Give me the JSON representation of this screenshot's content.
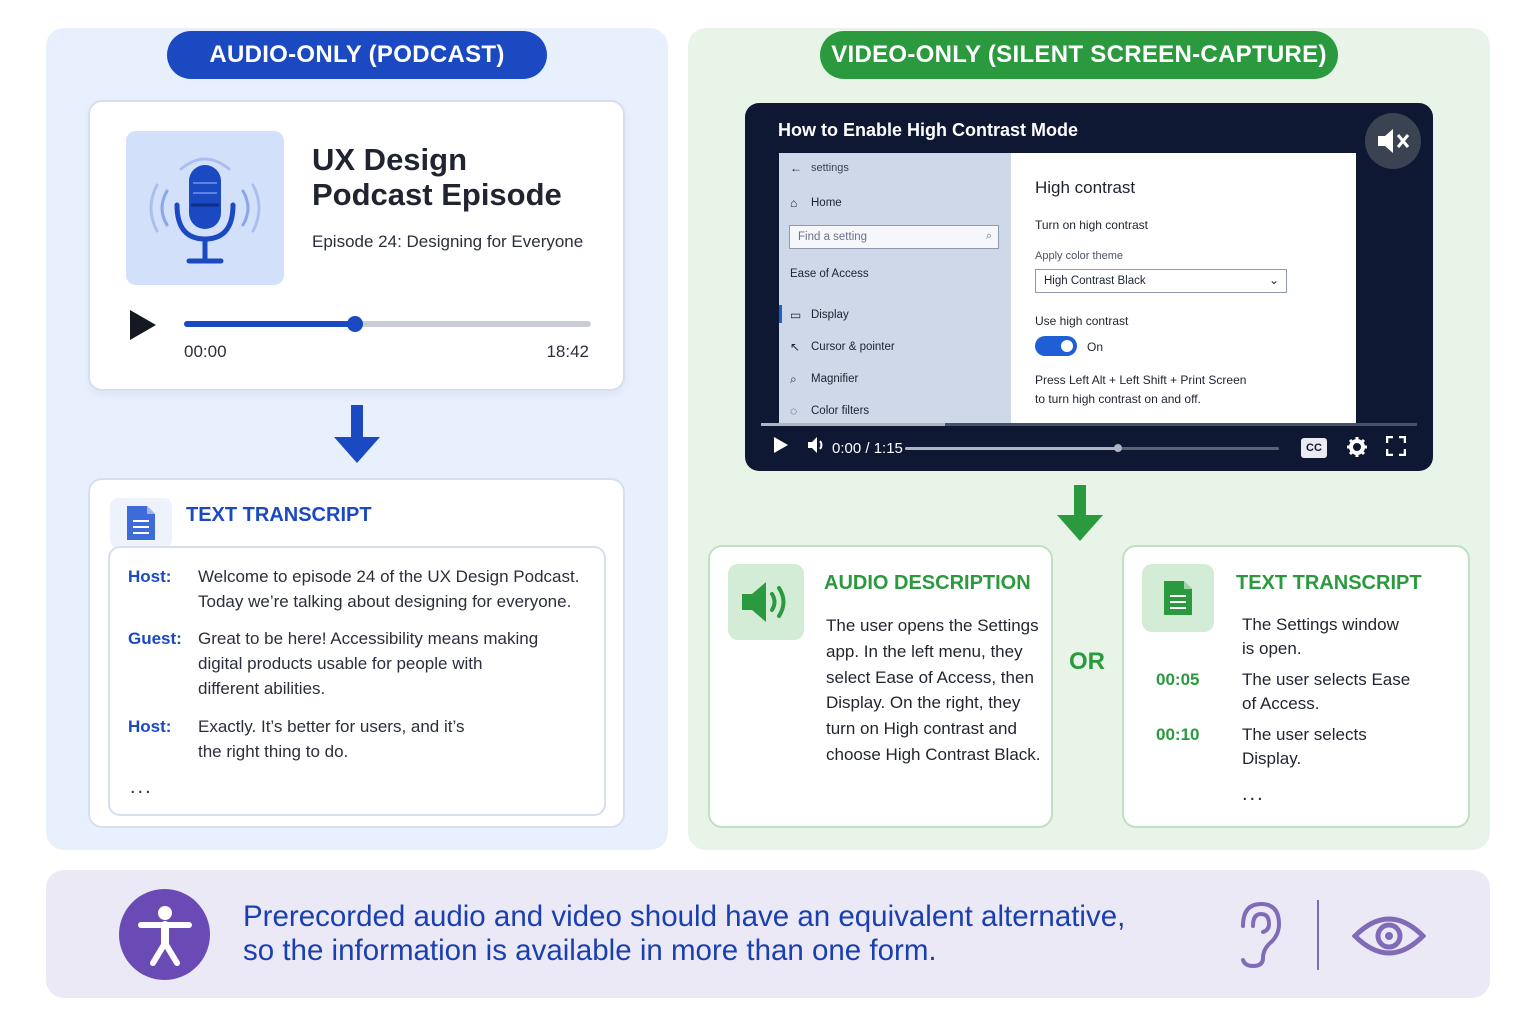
{
  "audio_section": {
    "label": "AUDIO-ONLY (PODCAST)",
    "player": {
      "title_line1": "UX Design",
      "title_line2": "Podcast Episode",
      "episode": "Episode 24: Designing for Everyone",
      "time_start": "00:00",
      "time_end": "18:42",
      "progress_fraction": 0.42,
      "icon": "microphone-icon"
    },
    "transcript": {
      "title": "TEXT TRANSCRIPT",
      "lines": [
        {
          "speaker": "Host:",
          "text_1": "Welcome to episode 24 of the UX Design Podcast.",
          "text_2": "Today we’re talking about designing for everyone."
        },
        {
          "speaker": "Guest:",
          "text_1": "Great to be here! Accessibility means making",
          "text_2": "digital products usable for people with",
          "text_3": "different abilities."
        },
        {
          "speaker": "Host:",
          "text_1": "Exactly. It’s better for users, and it’s",
          "text_2": "the right thing to do."
        }
      ],
      "ellipsis": "..."
    }
  },
  "video_section": {
    "label": "VIDEO-ONLY (SILENT SCREEN-CAPTURE)",
    "player": {
      "title": "How to Enable High Contrast Mode",
      "muted": true,
      "time": "0:00 / 1:15",
      "volume_fraction": 0.57,
      "seek_fraction": 0.28,
      "cc": "CC"
    },
    "screen": {
      "app_title": "settings",
      "home": "Home",
      "find_placeholder": "Find a setting",
      "group": "Ease of Access",
      "menu": [
        "Display",
        "Cursor & pointer",
        "Magnifier",
        "Color filters"
      ],
      "heading": "High contrast",
      "turn_on": "Turn on high contrast",
      "theme_label": "Apply color theme",
      "theme_value": "High Contrast Black",
      "use_label": "Use high contrast",
      "toggle_state": "On",
      "hint_1": "Press Left Alt + Left Shift + Print Screen",
      "hint_2": "to turn high contrast on and off."
    },
    "audio_description": {
      "title": "AUDIO DESCRIPTION",
      "lines": [
        "The user opens the Settings",
        "app. In the left menu, they",
        "select Ease of Access, then",
        "Display. On the right, they",
        "turn on High contrast and",
        "choose High Contrast Black."
      ]
    },
    "or_label": "OR",
    "text_transcript": {
      "title": "TEXT TRANSCRIPT",
      "rows": [
        {
          "time": "",
          "line_1": "The Settings window",
          "line_2": "is open."
        },
        {
          "time": "00:05",
          "line_1": "The user selects Ease",
          "line_2": "of Access."
        },
        {
          "time": "00:10",
          "line_1": "The user selects",
          "line_2": "Display."
        }
      ],
      "ellipsis": "..."
    }
  },
  "footer": {
    "line_1": "Prerecorded audio and video should have an equivalent alternative,",
    "line_2": "so the information is available in more than one form.",
    "icons": [
      "accessibility-icon",
      "ear-icon",
      "eye-icon"
    ]
  },
  "colors": {
    "audio_blue": "#1a49c2",
    "video_green": "#2b9a3e",
    "footer_purple": "#6a4bb6"
  }
}
